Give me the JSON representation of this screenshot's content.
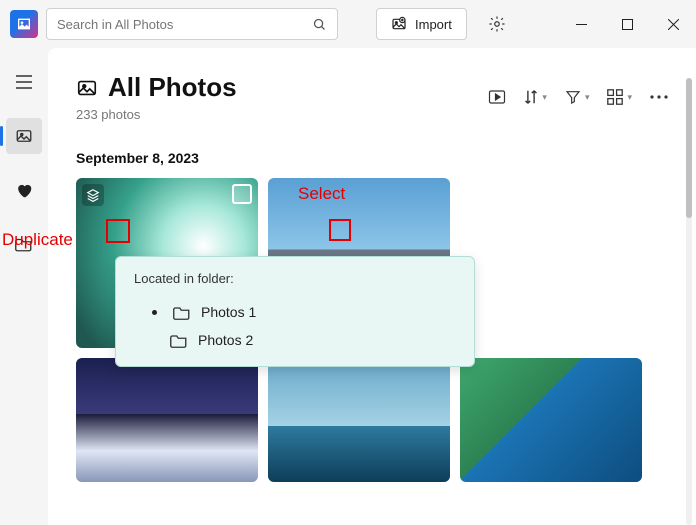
{
  "titlebar": {
    "search_placeholder": "Search in All Photos",
    "import_label": "Import"
  },
  "page": {
    "title": "All Photos",
    "subtitle": "233 photos",
    "date_group": "September 8, 2023"
  },
  "tooltip": {
    "title": "Located in folder:",
    "folders": [
      "Photos 1",
      "Photos 2"
    ]
  },
  "annotations": {
    "duplicate": "Duplicate",
    "select": "Select"
  }
}
